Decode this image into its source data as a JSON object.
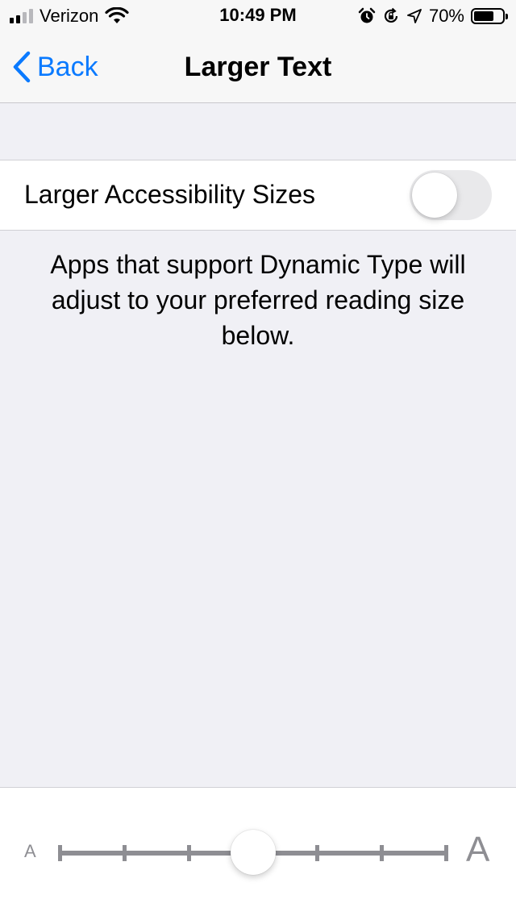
{
  "status_bar": {
    "carrier": "Verizon",
    "time": "10:49 PM",
    "battery_percent": "70%",
    "battery_level": 0.7,
    "signal_bars_active": 2,
    "signal_bars_total": 4,
    "icons": [
      "wifi-icon",
      "alarm-icon",
      "rotation-lock-icon",
      "location-arrow-icon",
      "battery-icon"
    ]
  },
  "nav": {
    "back_label": "Back",
    "title": "Larger Text"
  },
  "setting": {
    "label": "Larger Accessibility Sizes",
    "enabled": false
  },
  "footer": {
    "text": "Apps that support Dynamic Type will adjust to your preferred reading size below."
  },
  "slider": {
    "small_label": "A",
    "large_label": "A",
    "steps": 7,
    "selected_index": 3
  },
  "colors": {
    "accent": "#0a7aff",
    "background": "#f0f0f5",
    "track": "#8e8e93",
    "toggle_off": "#e9e9eb"
  }
}
